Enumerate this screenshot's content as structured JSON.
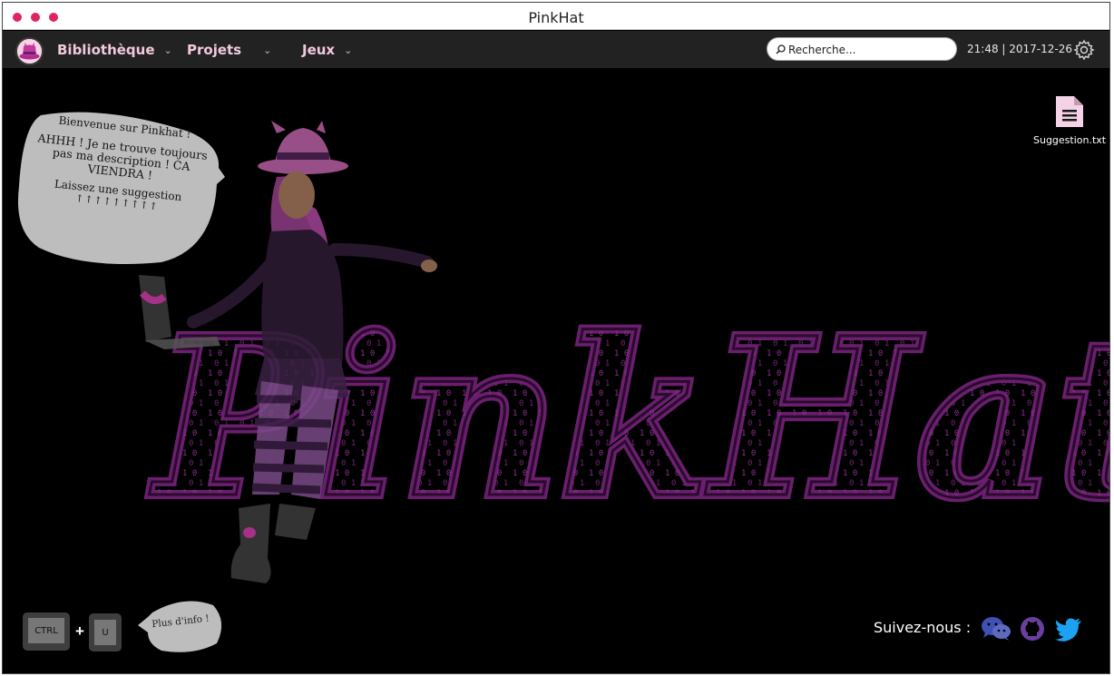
{
  "window": {
    "title": "PinkHat",
    "dot_color": "#e0245e"
  },
  "menubar": {
    "items": [
      {
        "label": "Bibliothèque"
      },
      {
        "label": "Projets"
      },
      {
        "label": "Jeux"
      }
    ],
    "search_placeholder": "Recherche...",
    "clock": "21:48 | 2017-12-26"
  },
  "welcome_bubble": {
    "greeting": "Bienvenue sur Pinkhat !",
    "message": "AHHH ! Je ne trouve toujours pas ma description ! CA VIENDRA !",
    "suggestion": "Laissez une suggestion",
    "arrows": "↑↑↑↑↑↑↑↑↑"
  },
  "desktop": {
    "brand_text": "PinkHat",
    "file": {
      "label": "Suggestion.txt",
      "icon": "document-icon"
    }
  },
  "shortcut": {
    "key1": "CTRL",
    "plus": "+",
    "key2": "U",
    "hint": "Plus d'info !"
  },
  "social": {
    "label": "Suivez-nous :",
    "icons": [
      "wechat-icon",
      "github-icon",
      "twitter-icon"
    ]
  },
  "colors": {
    "accent": "#e0245e",
    "brand_purple": "#6a1f6e",
    "nav_text": "#f2c9dd"
  }
}
